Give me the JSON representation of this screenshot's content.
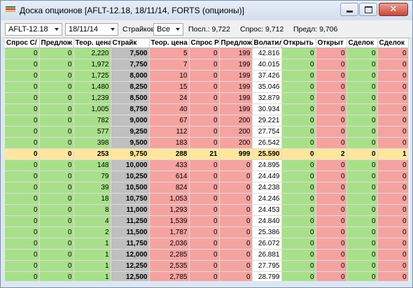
{
  "window": {
    "title": "Доска опционов [AFLT-12.18, 18/11/14, FORTS (опционы)]",
    "close_glyph": "✕"
  },
  "toolbar": {
    "instrument": "AFLT-12.18",
    "date": "18/11/14",
    "strikes_label": "Страйков:",
    "strikes_value": "Все",
    "last_label": "Посл.: 9,722",
    "bid_label": "Спрос: 9,712",
    "limit_label": "Предл: 9,706"
  },
  "colors": {
    "call_bg": "#a8e08a",
    "put_bg": "#f5a3a0",
    "strike_bg": "#bfbfbf",
    "atm_row_bg": "#ffe69c"
  },
  "table": {
    "columns": [
      "Спрос C/",
      "Предлож",
      "Теор. цена",
      "Страйк",
      "Теор. цена",
      "Спрос P",
      "Предлож",
      "Волатил",
      "Открыть",
      "Открыт",
      "Сделок",
      "Сделок"
    ],
    "rows": [
      [
        "0",
        "0",
        "2,220",
        "7,500",
        "5",
        "0",
        "199",
        "42.816",
        "0",
        "0",
        "0",
        "0"
      ],
      [
        "0",
        "0",
        "1,972",
        "7,750",
        "7",
        "0",
        "199",
        "40.015",
        "0",
        "0",
        "0",
        "0"
      ],
      [
        "0",
        "0",
        "1,725",
        "8,000",
        "10",
        "0",
        "199",
        "37.426",
        "0",
        "0",
        "0",
        "0"
      ],
      [
        "0",
        "0",
        "1,480",
        "8,250",
        "15",
        "0",
        "199",
        "35.046",
        "0",
        "0",
        "0",
        "0"
      ],
      [
        "0",
        "0",
        "1,239",
        "8,500",
        "24",
        "0",
        "199",
        "32.879",
        "0",
        "0",
        "0",
        "0"
      ],
      [
        "0",
        "0",
        "1,005",
        "8,750",
        "40",
        "0",
        "199",
        "30.934",
        "0",
        "0",
        "0",
        "0"
      ],
      [
        "0",
        "0",
        "782",
        "9,000",
        "67",
        "0",
        "200",
        "29.221",
        "0",
        "0",
        "0",
        "0"
      ],
      [
        "0",
        "0",
        "577",
        "9,250",
        "112",
        "0",
        "200",
        "27.754",
        "0",
        "0",
        "0",
        "0"
      ],
      [
        "0",
        "0",
        "398",
        "9,500",
        "183",
        "0",
        "200",
        "26.542",
        "0",
        "0",
        "0",
        "0"
      ],
      [
        "0",
        "0",
        "253",
        "9,750",
        "288",
        "21",
        "999",
        "25.590",
        "0",
        "2",
        "0",
        "1"
      ],
      [
        "0",
        "0",
        "148",
        "10,000",
        "433",
        "0",
        "0",
        "24.895",
        "0",
        "0",
        "0",
        "0"
      ],
      [
        "0",
        "0",
        "79",
        "10,250",
        "614",
        "0",
        "0",
        "24.449",
        "0",
        "0",
        "0",
        "0"
      ],
      [
        "0",
        "0",
        "39",
        "10,500",
        "824",
        "0",
        "0",
        "24.238",
        "0",
        "0",
        "0",
        "0"
      ],
      [
        "0",
        "0",
        "18",
        "10,750",
        "1,053",
        "0",
        "0",
        "24.246",
        "0",
        "0",
        "0",
        "0"
      ],
      [
        "0",
        "0",
        "8",
        "11,000",
        "1,293",
        "0",
        "0",
        "24.453",
        "0",
        "0",
        "0",
        "0"
      ],
      [
        "0",
        "0",
        "4",
        "11,250",
        "1,539",
        "0",
        "0",
        "24.840",
        "0",
        "0",
        "0",
        "0"
      ],
      [
        "0",
        "0",
        "2",
        "11,500",
        "1,787",
        "0",
        "0",
        "25.386",
        "0",
        "0",
        "0",
        "0"
      ],
      [
        "0",
        "0",
        "1",
        "11,750",
        "2,036",
        "0",
        "0",
        "26.072",
        "0",
        "0",
        "0",
        "0"
      ],
      [
        "0",
        "0",
        "1",
        "12,000",
        "2,285",
        "0",
        "0",
        "26.881",
        "0",
        "0",
        "0",
        "0"
      ],
      [
        "0",
        "0",
        "1",
        "12,250",
        "2,535",
        "0",
        "0",
        "27.795",
        "0",
        "0",
        "0",
        "0"
      ],
      [
        "0",
        "0",
        "1",
        "12,500",
        "2,785",
        "0",
        "0",
        "28.799",
        "0",
        "0",
        "0",
        "0"
      ]
    ]
  }
}
